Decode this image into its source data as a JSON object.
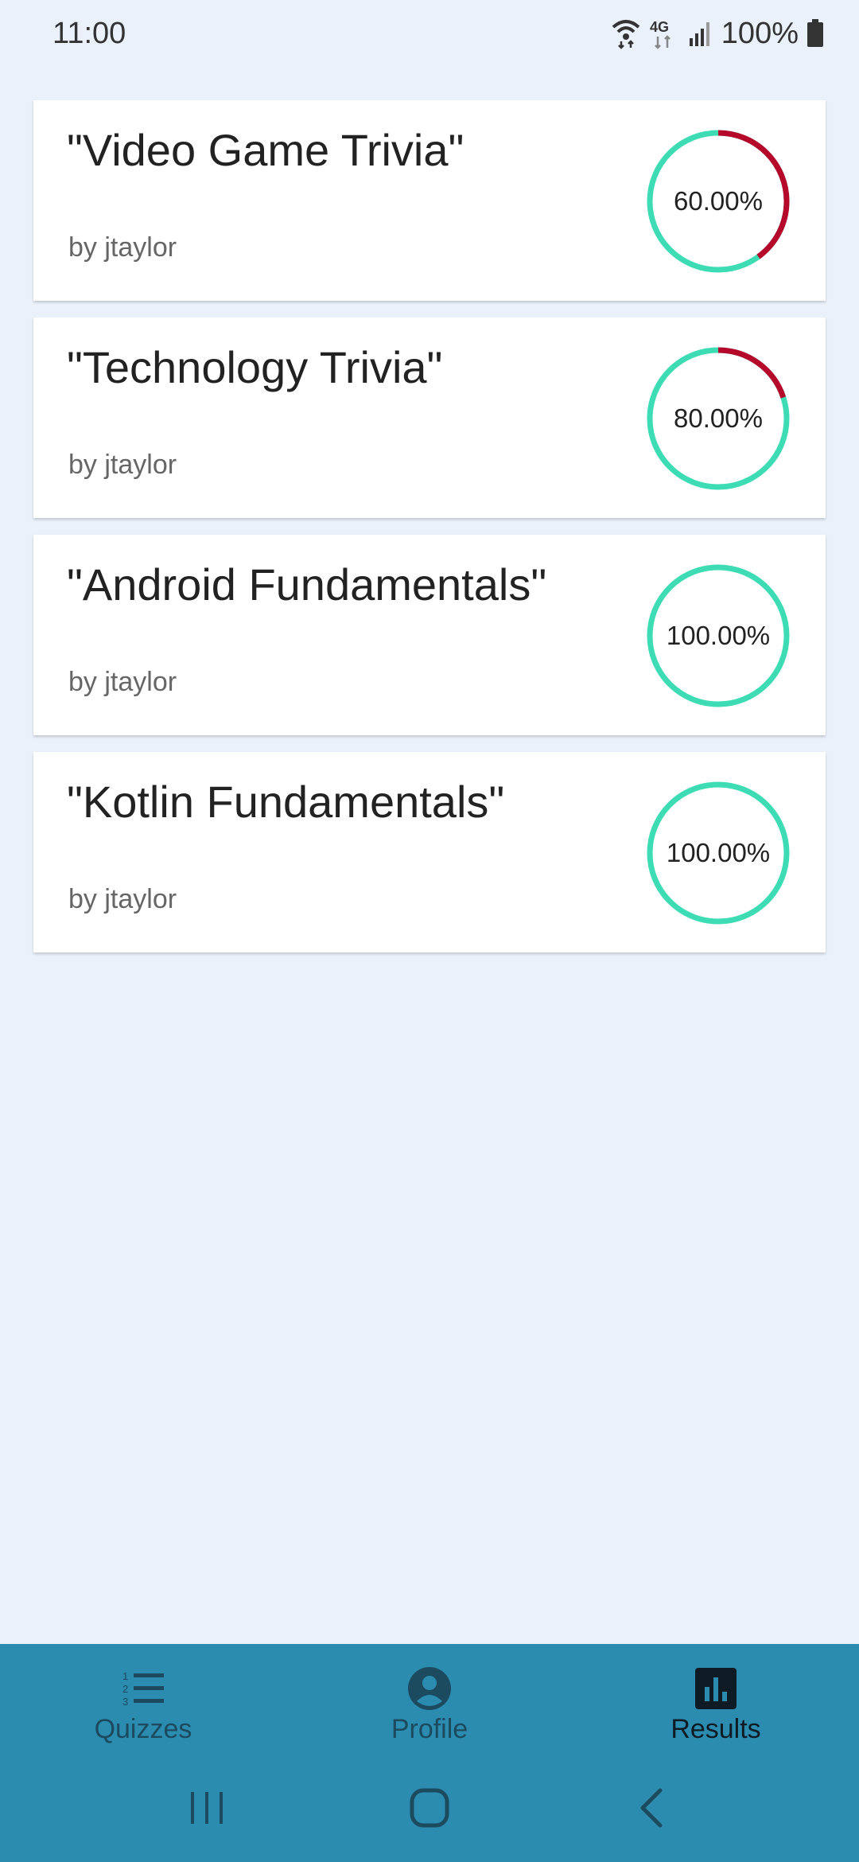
{
  "status_bar": {
    "time": "11:00",
    "battery": "100%",
    "icons": [
      "wifi-icon",
      "4g-lte-icon",
      "signal-icon",
      "battery-icon"
    ]
  },
  "results": [
    {
      "title": "\"Video Game Trivia\"",
      "author": "by jtaylor",
      "score_label": "60.00%",
      "score": 0.6
    },
    {
      "title": "\"Technology Trivia\"",
      "author": "by jtaylor",
      "score_label": "80.00%",
      "score": 0.8
    },
    {
      "title": "\"Android Fundamentals\"",
      "author": "by jtaylor",
      "score_label": "100.00%",
      "score": 1.0
    },
    {
      "title": "\"Kotlin Fundamentals\"",
      "author": "by jtaylor",
      "score_label": "100.00%",
      "score": 1.0
    }
  ],
  "colors": {
    "correct": "#3DDCB4",
    "incorrect": "#B5082A",
    "nav_background": "#2B8CB0",
    "page_background": "#EAF1FA"
  },
  "bottom_nav": {
    "items": [
      {
        "label": "Quizzes",
        "icon": "numbered-list-icon",
        "active": false
      },
      {
        "label": "Profile",
        "icon": "account-circle-icon",
        "active": false
      },
      {
        "label": "Results",
        "icon": "bar-chart-icon",
        "active": true
      }
    ]
  },
  "system_nav": {
    "icons": [
      "recent-apps-icon",
      "home-icon",
      "back-icon"
    ]
  }
}
